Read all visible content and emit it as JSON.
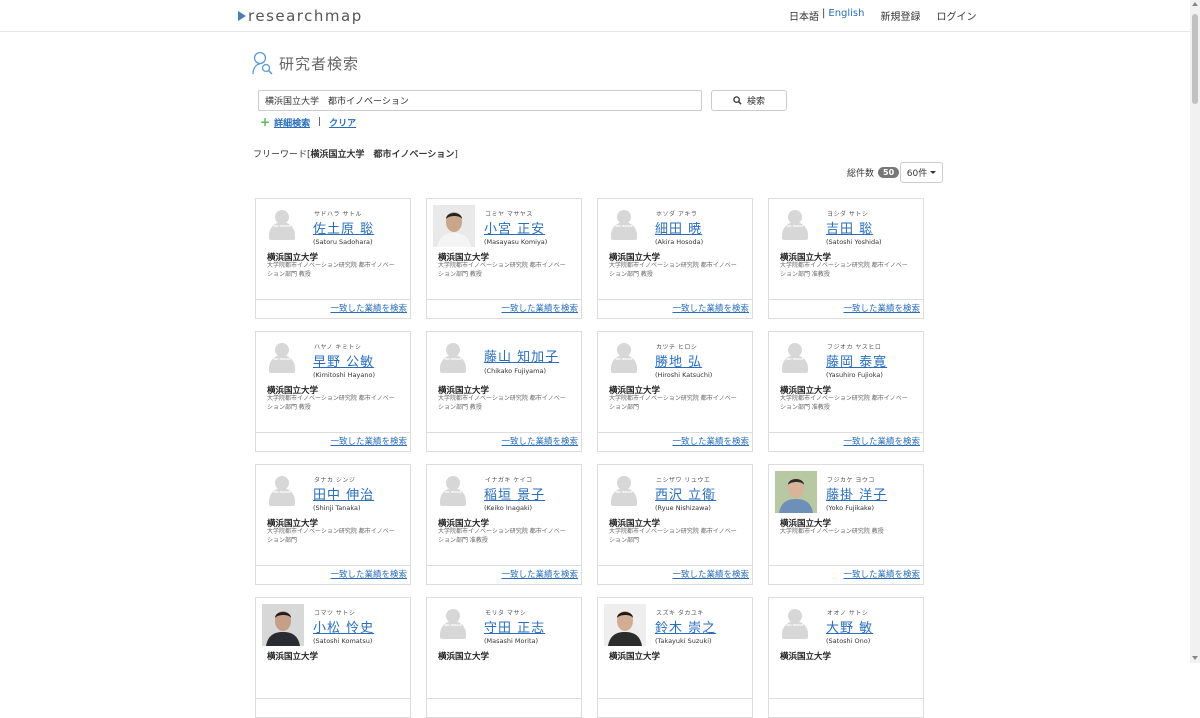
{
  "header": {
    "logo_text": "researchmap",
    "lang_ja": "日本語",
    "lang_sep": "|",
    "lang_en": "English",
    "register": "新規登録",
    "login": "ログイン"
  },
  "page": {
    "title": "研究者検索"
  },
  "search": {
    "value": "横浜国立大学　都市イノベーション",
    "button_label": "検索",
    "advanced_label": "詳細検索",
    "separator": "|",
    "clear_label": "クリア"
  },
  "results": {
    "freeword_prefix": "フリーワード[",
    "freeword_value": "横浜国立大学　都市イノベーション",
    "freeword_suffix": "]",
    "total_label": "総件数",
    "total_count": "50",
    "per_page": "60件"
  },
  "cards": [
    {
      "kana": "サドハラ サトル",
      "name": "佐土原 聡",
      "roman": "(Satoru Sadohara)",
      "inst": "横浜国立大学",
      "dept": "大学院都市イノベーション研究院 都市イノベーション部門 教授",
      "link": "一致した業績を検索",
      "photo": "no-image"
    },
    {
      "kana": "コミヤ マサヤス",
      "name": "小宮 正安",
      "roman": "(Masayasu Komiya)",
      "inst": "横浜国立大学",
      "dept": "大学院都市イノベーション研究院 都市イノベーション部門 教授",
      "link": "一致した業績を検索",
      "photo": "portrait-1"
    },
    {
      "kana": "ホソダ アキラ",
      "name": "細田 暁",
      "roman": "(Akira Hosoda)",
      "inst": "横浜国立大学",
      "dept": "大学院都市イノベーション研究院 都市イノベーション部門 教授",
      "link": "一致した業績を検索",
      "photo": "no-image"
    },
    {
      "kana": "ヨシダ サトシ",
      "name": "吉田 聡",
      "roman": "(Satoshi Yoshida)",
      "inst": "横浜国立大学",
      "dept": "大学院都市イノベーション研究院 都市イノベーション部門 准教授",
      "link": "一致した業績を検索",
      "photo": "no-image"
    },
    {
      "kana": "ハヤノ キミトシ",
      "name": "早野 公敏",
      "roman": "(Kimitoshi Hayano)",
      "inst": "横浜国立大学",
      "dept": "大学院都市イノベーション研究院 都市イノベーション部門 教授",
      "link": "一致した業績を検索",
      "photo": "no-image"
    },
    {
      "kana": "",
      "name": "藤山 知加子",
      "roman": "(Chikako Fujiyama)",
      "inst": "横浜国立大学",
      "dept": "大学院都市イノベーション研究院 都市イノベーション部門 教授",
      "link": "一致した業績を検索",
      "photo": "no-image"
    },
    {
      "kana": "カツチ ヒロシ",
      "name": "勝地 弘",
      "roman": "(Hiroshi Katsuchi)",
      "inst": "横浜国立大学",
      "dept": "大学院都市イノベーション研究院 都市イノベーション部門",
      "link": "一致した業績を検索",
      "photo": "no-image"
    },
    {
      "kana": "フジオカ ヤスヒロ",
      "name": "藤岡 泰寛",
      "roman": "(Yasuhiro Fujioka)",
      "inst": "横浜国立大学",
      "dept": "大学院都市イノベーション研究院 都市イノベーション部門 准教授",
      "link": "一致した業績を検索",
      "photo": "no-image"
    },
    {
      "kana": "タナカ シンジ",
      "name": "田中 伸治",
      "roman": "(Shinji Tanaka)",
      "inst": "横浜国立大学",
      "dept": "大学院都市イノベーション研究院 都市イノベーション部門",
      "link": "一致した業績を検索",
      "photo": "no-image"
    },
    {
      "kana": "イナガキ ケイコ",
      "name": "稲垣 景子",
      "roman": "(Keiko Inagaki)",
      "inst": "横浜国立大学",
      "dept": "大学院都市イノベーション研究院 都市イノベーション部門 准教授",
      "link": "一致した業績を検索",
      "photo": "no-image"
    },
    {
      "kana": "ニシザワ リュウエ",
      "name": "西沢 立衛",
      "roman": "(Ryue Nishizawa)",
      "inst": "横浜国立大学",
      "dept": "大学院都市イノベーション研究院 都市イノベーション部門",
      "link": "一致した業績を検索",
      "photo": "no-image"
    },
    {
      "kana": "フジカケ ヨウコ",
      "name": "藤掛 洋子",
      "roman": "(Yoko Fujikake)",
      "inst": "横浜国立大学",
      "dept": "大学院都市イノベーション研究院 教授",
      "link": "一致した業績を検索",
      "photo": "portrait-2"
    },
    {
      "kana": "コマツ サトシ",
      "name": "小松 怜史",
      "roman": "(Satoshi Komatsu)",
      "inst": "横浜国立大学",
      "dept": "",
      "link": "",
      "photo": "portrait-3"
    },
    {
      "kana": "モリタ マサシ",
      "name": "守田 正志",
      "roman": "(Masashi Morita)",
      "inst": "横浜国立大学",
      "dept": "",
      "link": "",
      "photo": "no-image"
    },
    {
      "kana": "スズキ タカユキ",
      "name": "鈴木 崇之",
      "roman": "(Takayuki Suzuki)",
      "inst": "横浜国立大学",
      "dept": "",
      "link": "",
      "photo": "portrait-4"
    },
    {
      "kana": "オオノ サトシ",
      "name": "大野 敏",
      "roman": "(Satoshi Ono)",
      "inst": "横浜国立大学",
      "dept": "",
      "link": "",
      "photo": "no-image"
    }
  ],
  "no_image_text": "NO IMAGE",
  "colors": {
    "link": "#2a6ebb",
    "badge": "#777777",
    "plus": "#5cb85c"
  }
}
